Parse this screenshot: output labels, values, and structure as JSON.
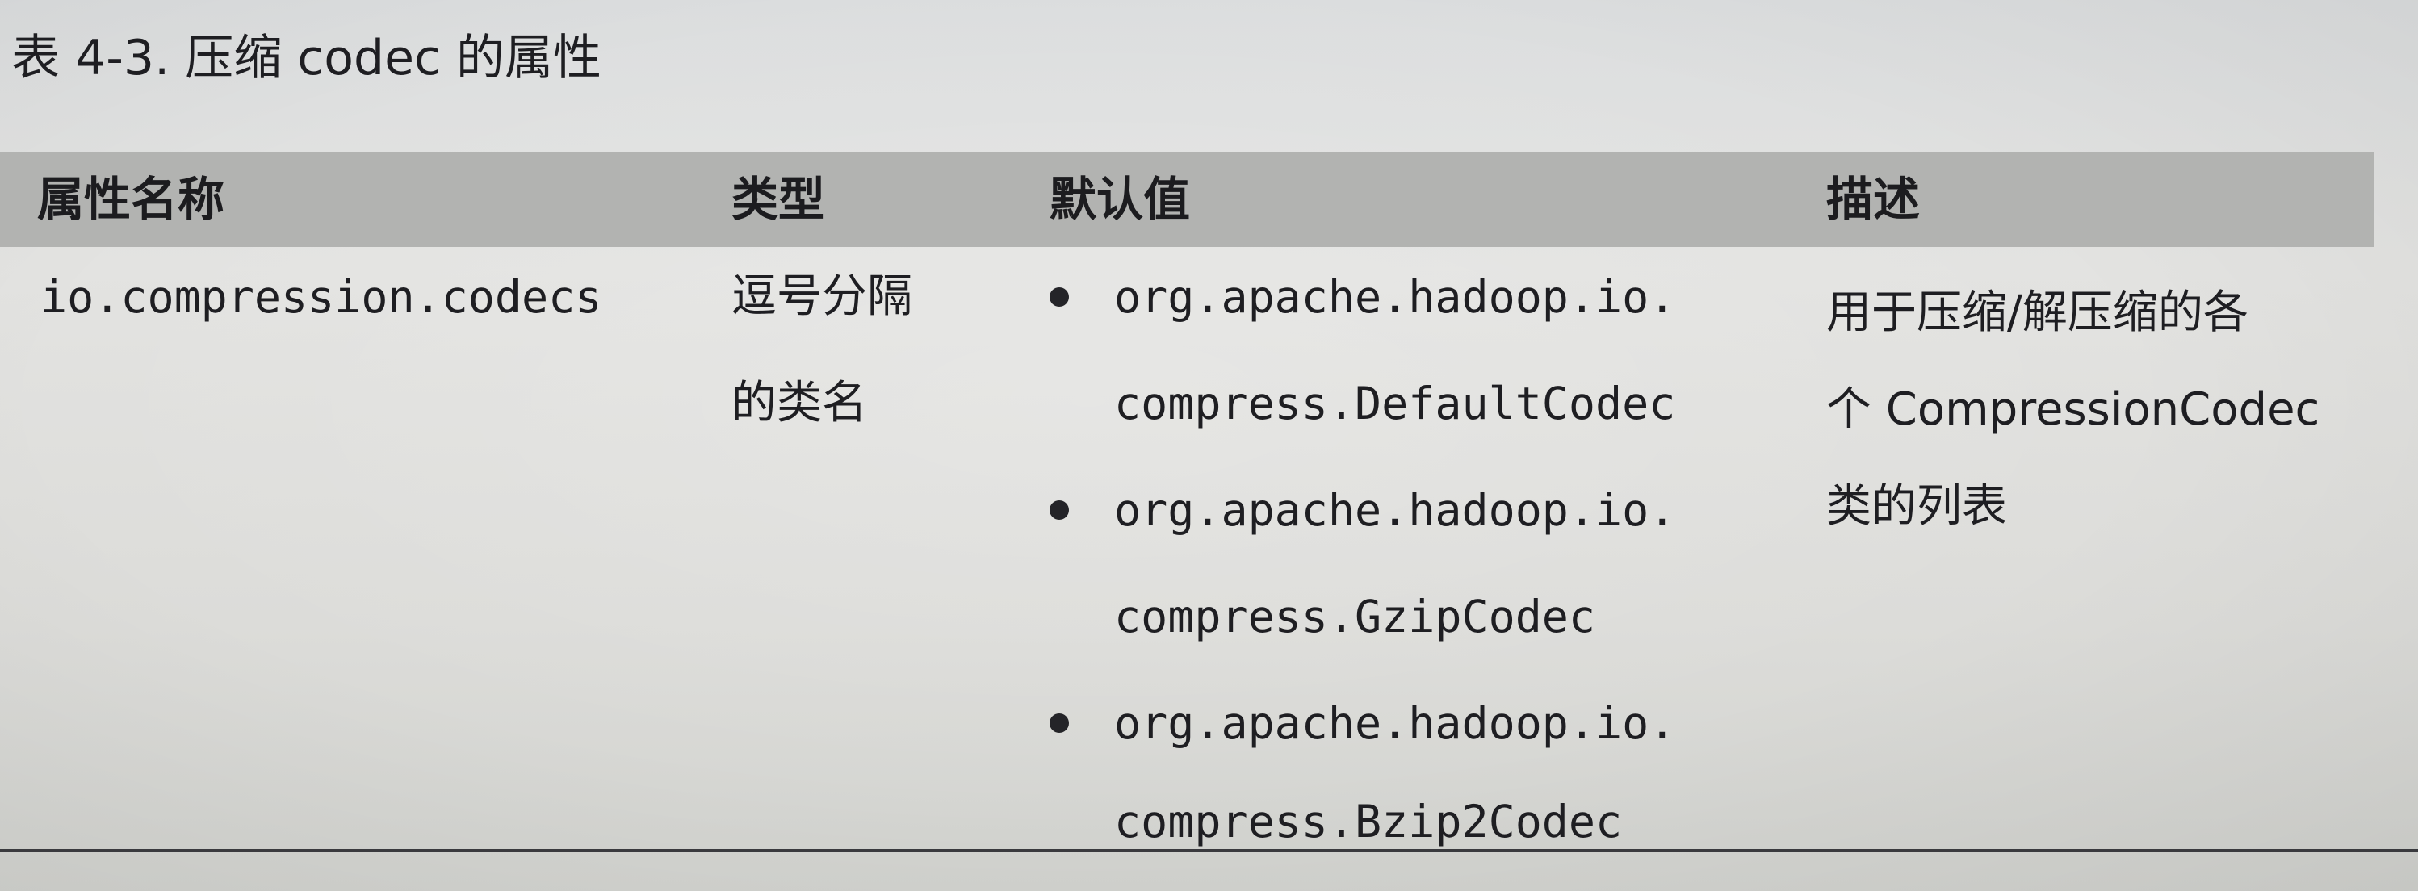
{
  "caption": "表 4-3. 压缩 codec 的属性",
  "table": {
    "headers": [
      "属性名称",
      "类型",
      "默认值",
      "描述"
    ],
    "row": {
      "property_name": "io.compression.codecs",
      "type_lines": [
        "逗号分隔",
        "的类名"
      ],
      "default_values": [
        [
          "org.apache.hadoop.io.",
          "compress.DefaultCodec"
        ],
        [
          "org.apache.hadoop.io.",
          "compress.GzipCodec"
        ],
        [
          "org.apache.hadoop.io.",
          "compress.Bzip2Codec"
        ]
      ],
      "description_lines": [
        "用于压缩/解压缩的各",
        "个 CompressionCodec",
        "类的列表"
      ]
    }
  }
}
